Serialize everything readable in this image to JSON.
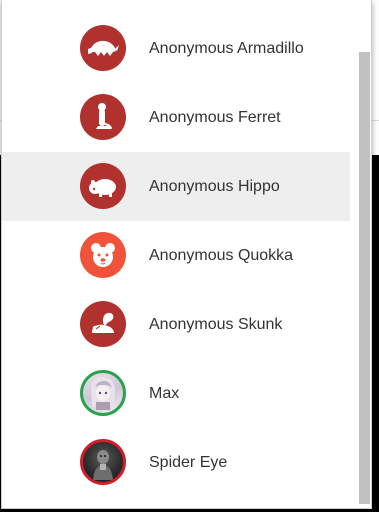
{
  "users": [
    {
      "name": "Anonymous Armadillo",
      "avatar_icon": "armadillo-icon",
      "avatar_color": "#b0312d",
      "highlighted": false
    },
    {
      "name": "Anonymous Ferret",
      "avatar_icon": "ferret-icon",
      "avatar_color": "#b0312d",
      "highlighted": false
    },
    {
      "name": "Anonymous Hippo",
      "avatar_icon": "hippo-icon",
      "avatar_color": "#b0312d",
      "highlighted": true
    },
    {
      "name": "Anonymous Quokka",
      "avatar_icon": "quokka-icon",
      "avatar_color": "#f0533a",
      "highlighted": false
    },
    {
      "name": "Anonymous Skunk",
      "avatar_icon": "skunk-icon",
      "avatar_color": "#b0312d",
      "highlighted": false
    },
    {
      "name": "Max",
      "avatar_icon": "user-photo",
      "avatar_color": "#2aa14a",
      "highlighted": false
    },
    {
      "name": "Spider Eye",
      "avatar_icon": "user-photo",
      "avatar_color": "#d01f2a",
      "highlighted": false
    }
  ],
  "colors": {
    "highlight_bg": "#eeeeee",
    "text": "#333333",
    "scrollbar_thumb": "#c1c1c1"
  }
}
